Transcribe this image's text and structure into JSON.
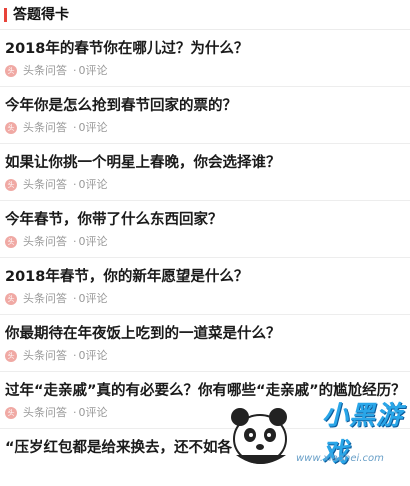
{
  "header": {
    "title": "答题得卡"
  },
  "items": [
    {
      "question": "2018年的春节你在哪儿过？为什么？",
      "source": "头条问答",
      "comments": "0评论"
    },
    {
      "question": "今年你是怎么抢到春节回家的票的？",
      "source": "头条问答",
      "comments": "0评论"
    },
    {
      "question": "如果让你挑一个明星上春晚，你会选择谁？",
      "source": "头条问答",
      "comments": "0评论"
    },
    {
      "question": "今年春节，你带了什么东西回家？",
      "source": "头条问答",
      "comments": "0评论"
    },
    {
      "question": "2018年春节，你的新年愿望是什么？",
      "source": "头条问答",
      "comments": "0评论"
    },
    {
      "question": "你最期待在年夜饭上吃到的一道菜是什么？",
      "source": "头条问答",
      "comments": "0评论"
    },
    {
      "question": "过年“走亲戚”真的有必要么？你有哪些“走亲戚”的尴尬经历？",
      "source": "头条问答",
      "comments": "0评论"
    },
    {
      "question": "“压岁红包都是给来换去，还不如各",
      "source": "",
      "comments": ""
    }
  ],
  "watermark": {
    "brand": "小黑游戏",
    "url": "www.xiaohei.com"
  },
  "colors": {
    "accent": "#e8433a",
    "divider": "#ededed",
    "meta": "#999999"
  }
}
